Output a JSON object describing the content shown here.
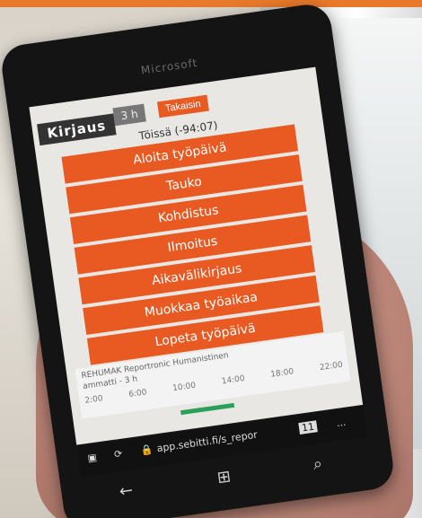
{
  "phone": {
    "brand": "Microsoft"
  },
  "app": {
    "title": "Kirjaus",
    "hours_badge": "3 h",
    "back_label": "Takaisin",
    "status": "Töissä (-94:07)"
  },
  "actions": [
    {
      "label": "Aloita työpäivä"
    },
    {
      "label": "Tauko"
    },
    {
      "label": "Kohdistus"
    },
    {
      "label": "Ilmoitus"
    },
    {
      "label": "Aikavälikirjaus"
    },
    {
      "label": "Muokkaa työaikaa"
    },
    {
      "label": "Lopeta työpäivä"
    }
  ],
  "footer": {
    "line1": "REHUMAK Reportronic Humanistinen",
    "line2": "ammatti - 3 h",
    "timeline": [
      "2:00",
      "6:00",
      "10:00",
      "14:00",
      "18:00",
      "22:00"
    ]
  },
  "browser": {
    "address": "app.sebitti.fi/s_repor",
    "tabs_count": "11",
    "menu": "..."
  },
  "colors": {
    "accent": "#e85a22",
    "badge": "#777777",
    "progress": "#2aa05a"
  }
}
